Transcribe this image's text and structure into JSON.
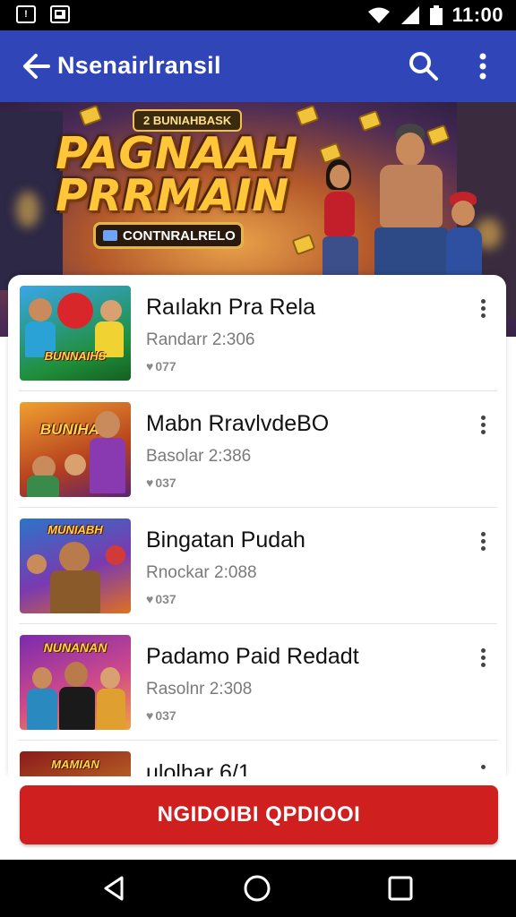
{
  "status_bar": {
    "time": "11:00",
    "left_icons": [
      "notification-icon",
      "photo-icon"
    ],
    "right_icons": [
      "wifi-icon",
      "signal-icon",
      "battery-icon"
    ]
  },
  "app_bar": {
    "title": "Nsenairlransil",
    "icons": [
      "back-arrow-icon",
      "search-icon",
      "more-vert-icon"
    ],
    "color": "#2f45b8"
  },
  "banner": {
    "tagline": "2 BUNIAHBASK",
    "headline_line1": "PAGNAAH",
    "headline_line2": "PRRMAIN",
    "pill_label": "CONTNRALRELO"
  },
  "list": {
    "items": [
      {
        "title": "Raılakn Pra Rela",
        "subtitle": "Randarr 2:306",
        "count": "077",
        "thumb_text": "BUNNAIHS"
      },
      {
        "title": "Mabn RravlvdeBO",
        "subtitle": "Basolar 2:386",
        "count": "037",
        "thumb_text": "BUNIHAN"
      },
      {
        "title": "Bingatan Pudah",
        "subtitle": "Rnockar 2:088",
        "count": "037",
        "thumb_text": "MUNIABH"
      },
      {
        "title": "Padamo Paid Redadt",
        "subtitle": "Rasolnr 2:308",
        "count": "037",
        "thumb_text": "NUNANAN"
      },
      {
        "title": "ulolhar 6/1",
        "subtitle": "",
        "count": "",
        "thumb_text": "MAMIAN"
      }
    ]
  },
  "cta": {
    "label": "NGIDOIBI QPDIOOI",
    "color": "#cf1f1f"
  },
  "nav_bar": {
    "icons": [
      "back-triangle-icon",
      "home-circle-icon",
      "recents-square-icon"
    ]
  }
}
